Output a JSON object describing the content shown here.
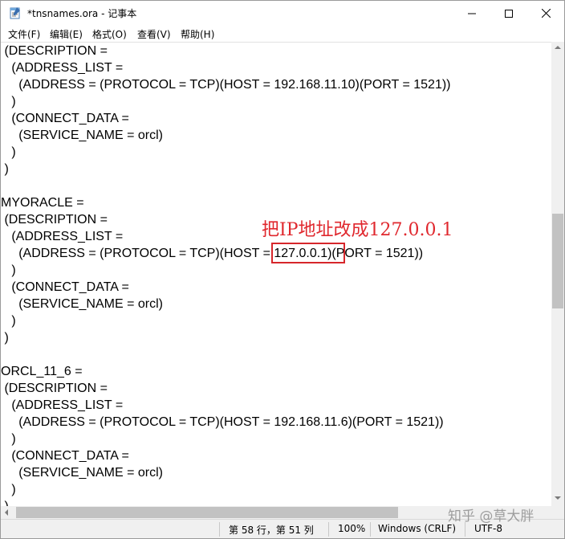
{
  "window": {
    "title": "*tnsnames.ora - 记事本"
  },
  "menu": [
    "文件(F)",
    "编辑(E)",
    "格式(O)",
    "查看(V)",
    "帮助(H)"
  ],
  "editor": {
    "lines": [
      " (DESCRIPTION =",
      "   (ADDRESS_LIST =",
      "     (ADDRESS = (PROTOCOL = TCP)(HOST = 192.168.11.10)(PORT = 1521))",
      "   )",
      "   (CONNECT_DATA =",
      "     (SERVICE_NAME = orcl)",
      "   )",
      " )",
      "",
      "MYORACLE =",
      " (DESCRIPTION =",
      "   (ADDRESS_LIST =",
      "     (ADDRESS = (PROTOCOL = TCP)(HOST = 127.0.0.1)(PORT = 1521))",
      "   )",
      "   (CONNECT_DATA =",
      "     (SERVICE_NAME = orcl)",
      "   )",
      " )",
      "",
      "ORCL_11_6 =",
      " (DESCRIPTION =",
      "   (ADDRESS_LIST =",
      "     (ADDRESS = (PROTOCOL = TCP)(HOST = 192.168.11.6)(PORT = 1521))",
      "   )",
      "   (CONNECT_DATA =",
      "     (SERVICE_NAME = orcl)",
      "   )",
      " )"
    ]
  },
  "annotation": {
    "text": "把IP地址改成127.0.0.1",
    "color": "#e0282e"
  },
  "status": {
    "position": "第 58 行，第 51 列",
    "zoom": "100%",
    "line_ending": "Windows (CRLF)",
    "encoding": "UTF-8"
  },
  "watermark": "知乎 @草大胖",
  "icons": {
    "app": "notepad-icon",
    "minimize": "minimize-icon",
    "maximize": "maximize-icon",
    "close": "close-icon"
  }
}
